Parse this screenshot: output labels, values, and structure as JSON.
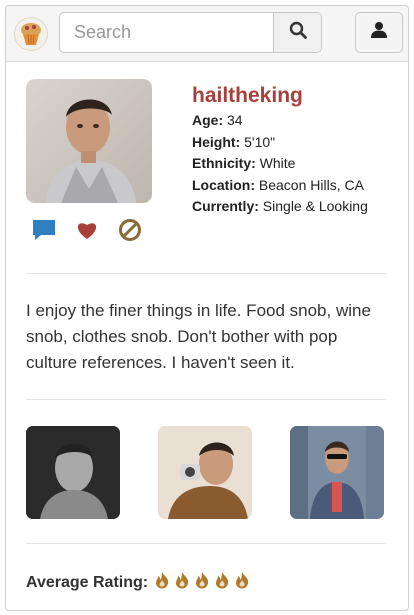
{
  "header": {
    "search_placeholder": "Search",
    "search_value": "",
    "logo_icon": "cupcake-logo-icon",
    "search_icon": "search-icon",
    "account_icon": "user-icon"
  },
  "profile": {
    "username": "hailtheking",
    "details": [
      {
        "label": "Age:",
        "value": "34"
      },
      {
        "label": "Height:",
        "value": "5'10\""
      },
      {
        "label": "Ethnicity:",
        "value": "White"
      },
      {
        "label": "Location:",
        "value": "Beacon Hills, CA"
      },
      {
        "label": "Currently:",
        "value": "Single & Looking"
      }
    ],
    "actions": [
      "message-icon",
      "heart-icon",
      "block-icon"
    ],
    "bio": "I enjoy the finer things in life. Food snob, wine snob, clothes snob. Don't bother with pop culture references. I haven't seen it."
  },
  "rating": {
    "label": "Average Rating:",
    "value": 5,
    "max": 5,
    "icon": "flame-icon"
  },
  "colors": {
    "username": "#a8403c",
    "message_icon": "#2f7fc1",
    "heart_icon": "#a8403c",
    "block_icon": "#8a6a3a",
    "rating_icon": "#b07a2a"
  }
}
